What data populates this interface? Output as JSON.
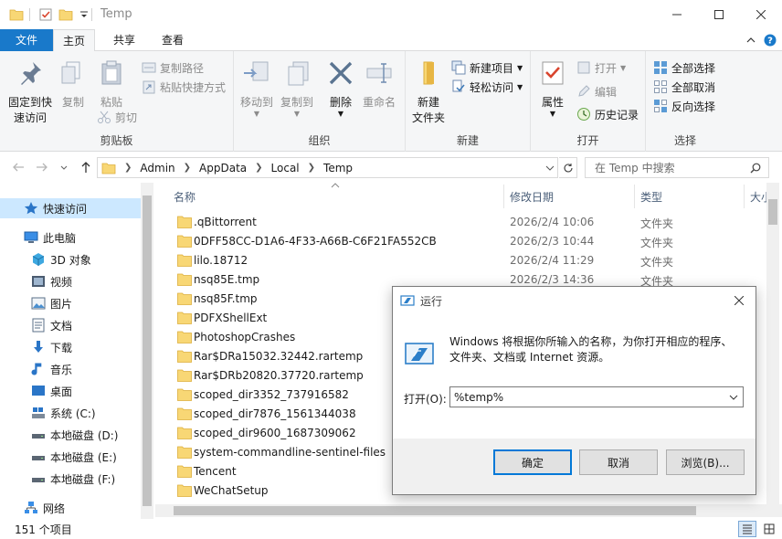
{
  "window": {
    "title": "Temp",
    "minimize": "—",
    "maximize": "☐",
    "close": "✕"
  },
  "ribbon_tabs": {
    "file": "文件",
    "home": "主页",
    "share": "共享",
    "view": "查看"
  },
  "ribbon": {
    "clipboard": {
      "label": "剪贴板",
      "pin": "固定到快\n速访问",
      "pin_l1": "固定到快",
      "pin_l2": "速访问",
      "copy": "复制",
      "paste": "粘贴",
      "copy_path": "复制路径",
      "paste_shortcut": "粘贴快捷方式",
      "cut": "剪切"
    },
    "organize": {
      "label": "组织",
      "move_to": "移动到",
      "copy_to": "复制到",
      "delete": "删除",
      "rename": "重命名"
    },
    "new": {
      "label": "新建",
      "new_folder_l1": "新建",
      "new_folder_l2": "文件夹",
      "new_item": "新建项目",
      "easy_access": "轻松访问"
    },
    "open": {
      "label": "打开",
      "properties": "属性",
      "open": "打开",
      "edit": "编辑",
      "history": "历史记录"
    },
    "select": {
      "label": "选择",
      "select_all": "全部选择",
      "select_none": "全部取消",
      "invert": "反向选择"
    }
  },
  "address": {
    "segments": [
      "Admin",
      "AppData",
      "Local",
      "Temp"
    ],
    "search_placeholder": "在 Temp 中搜索"
  },
  "nav": {
    "quick_access": "快速访问",
    "this_pc": "此电脑",
    "objects3d": "3D 对象",
    "videos": "视频",
    "pictures": "图片",
    "documents": "文档",
    "downloads": "下载",
    "music": "音乐",
    "desktop": "桌面",
    "drive_c": "系统 (C:)",
    "drive_d": "本地磁盘 (D:)",
    "drive_e": "本地磁盘 (E:)",
    "drive_f": "本地磁盘 (F:)",
    "network": "网络"
  },
  "columns": {
    "name": "名称",
    "date": "修改日期",
    "type": "类型",
    "size": "大小"
  },
  "files": [
    {
      "name": ".qBittorrent",
      "date": "2026/2/4 10:06",
      "type": "文件夹"
    },
    {
      "name": "0DFF58CC-D1A6-4F33-A66B-C6F21FA552CB",
      "date": "2026/2/3 10:44",
      "type": "文件夹"
    },
    {
      "name": "lilo.18712",
      "date": "2026/2/4 11:29",
      "type": "文件夹"
    },
    {
      "name": "nsq85E.tmp",
      "date": "2026/2/3 14:36",
      "type": "文件夹"
    },
    {
      "name": "nsq85F.tmp",
      "date": "",
      "type": ""
    },
    {
      "name": "PDFXShellExt",
      "date": "",
      "type": ""
    },
    {
      "name": "PhotoshopCrashes",
      "date": "",
      "type": ""
    },
    {
      "name": "Rar$DRa15032.32442.rartemp",
      "date": "",
      "type": ""
    },
    {
      "name": "Rar$DRb20820.37720.rartemp",
      "date": "",
      "type": ""
    },
    {
      "name": "scoped_dir3352_737916582",
      "date": "",
      "type": ""
    },
    {
      "name": "scoped_dir7876_1561344038",
      "date": "",
      "type": ""
    },
    {
      "name": "scoped_dir9600_1687309062",
      "date": "",
      "type": ""
    },
    {
      "name": "system-commandline-sentinel-files",
      "date": "",
      "type": ""
    },
    {
      "name": "Tencent",
      "date": "",
      "type": ""
    },
    {
      "name": "WeChatSetup",
      "date": "",
      "type": ""
    }
  ],
  "status": {
    "count": "151 个项目"
  },
  "run_dialog": {
    "title": "运行",
    "description_l1": "Windows 将根据你所输入的名称，为你打开相应的程序、",
    "description_l2": "文件夹、文档或 Internet 资源。",
    "open_label": "打开(O):",
    "input_value": "%temp%",
    "ok": "确定",
    "cancel": "取消",
    "browse": "浏览(B)..."
  },
  "colors": {
    "accent": "#1979ca",
    "folder": "#f8d775",
    "selection": "#cce8ff"
  }
}
